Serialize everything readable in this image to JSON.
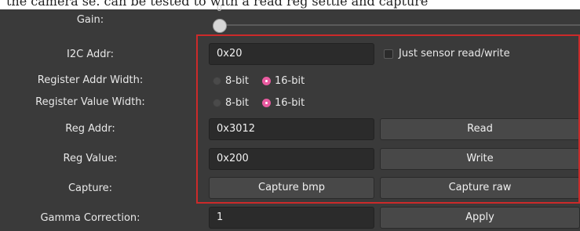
{
  "top_strip_text": "the camera se. can be tested to with a read reg settle and capture",
  "gain": {
    "label": "Gain:",
    "value_text": "0",
    "level": 0
  },
  "i2c_addr": {
    "label": "I2C Addr:",
    "value": "0x20"
  },
  "sensor_only": {
    "label": "Just sensor read/write",
    "checked": false
  },
  "reg_addr_width": {
    "label": "Register Addr Width:",
    "options": [
      "8-bit",
      "16-bit"
    ],
    "selected": "16-bit"
  },
  "reg_value_width": {
    "label": "Register Value Width:",
    "options": [
      "8-bit",
      "16-bit"
    ],
    "selected": "16-bit"
  },
  "reg_addr": {
    "label": "Reg Addr:",
    "value": "0x3012",
    "button": "Read"
  },
  "reg_value": {
    "label": "Reg Value:",
    "value": "0x200",
    "button": "Write"
  },
  "capture": {
    "label": "Capture:",
    "bmp_button": "Capture bmp",
    "raw_button": "Capture raw"
  },
  "gamma": {
    "label": "Gamma Correction:",
    "value": "1",
    "button": "Apply"
  },
  "colors": {
    "highlight": "#cc2a2a",
    "accent": "#e95ba0",
    "background": "#3a3a3a"
  }
}
